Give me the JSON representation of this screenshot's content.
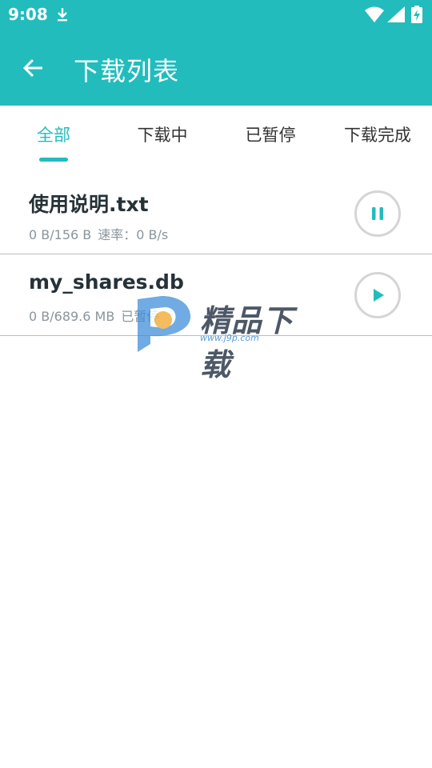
{
  "status_bar": {
    "time": "9:08",
    "icons": [
      "download-icon",
      "wifi-icon",
      "signal-icon",
      "battery-charging-icon"
    ]
  },
  "toolbar": {
    "back_icon": "arrow-left-icon",
    "title": "下载列表"
  },
  "tabs": [
    {
      "label": "全部",
      "active": true
    },
    {
      "label": "下载中",
      "active": false
    },
    {
      "label": "已暂停",
      "active": false
    },
    {
      "label": "下载完成",
      "active": false
    }
  ],
  "downloads": [
    {
      "name": "使用说明.txt",
      "progress": "0 B/156 B",
      "speed": "速率：0 B/s",
      "status": "",
      "action_icon": "pause-icon"
    },
    {
      "name": "my_shares.db",
      "progress": "0 B/689.6 MB",
      "speed": "",
      "status": "已暂停",
      "action_icon": "play-icon"
    }
  ],
  "watermark": {
    "text": "精品下载",
    "url": "www.j9p.com"
  },
  "colors": {
    "primary": "#22bcbd",
    "text_dark": "#263238",
    "text_secondary": "#8a959c"
  }
}
